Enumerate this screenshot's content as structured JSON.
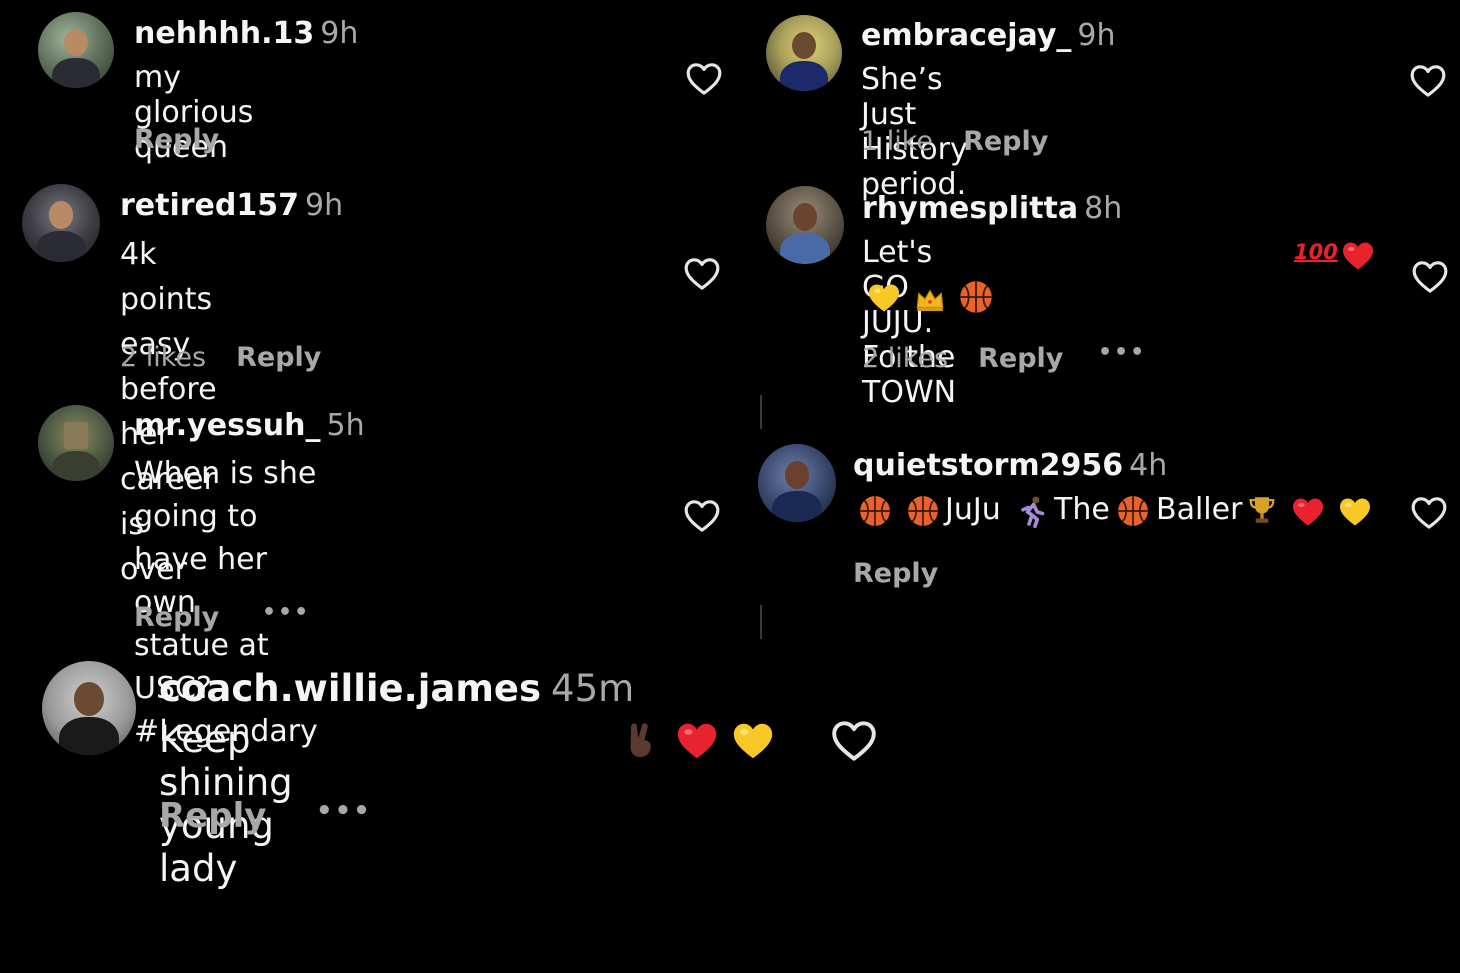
{
  "comments": [
    {
      "id": "c1",
      "username": "nehhhh.13",
      "time": "9h",
      "lines": [
        "my glorious queen"
      ],
      "likes": "",
      "reply": "Reply"
    },
    {
      "id": "c2",
      "username": "retired157",
      "time": "9h",
      "lines": [
        "4k points easy before her career is",
        "over"
      ],
      "likes": "2 likes",
      "reply": "Reply"
    },
    {
      "id": "c3",
      "username": "mr.yessuh_",
      "time": "5h",
      "lines": [
        "When is she going to have her own",
        "statue at USC?",
        "#Legendary"
      ],
      "likes": "",
      "reply": "Reply",
      "more": "•••"
    },
    {
      "id": "c4",
      "username": "embracejay_",
      "time": "9h",
      "lines": [
        "She’s Just History period."
      ],
      "likes": "1 like",
      "reply": "Reply"
    },
    {
      "id": "c5",
      "username": "rhymesplitta",
      "time": "8h",
      "lines": [
        "Let's GO JUJU. Fo the TOWN"
      ],
      "likes": "2 likes",
      "reply": "Reply",
      "more": "•••"
    },
    {
      "id": "c6",
      "username": "quietstorm2956",
      "time": "4h",
      "text_parts": [
        "JuJu",
        "The",
        "Baller"
      ],
      "likes": "",
      "reply": "Reply"
    },
    {
      "id": "c7",
      "username": "coach.willie.james",
      "time": "45m",
      "lines": [
        "Keep shining young lady"
      ],
      "likes": "",
      "reply": "Reply",
      "more": "•••"
    }
  ],
  "emoji_glyphs": {
    "hundred": "100"
  },
  "icons": [
    "heart-outline-icon",
    "basketball-icon",
    "crown-icon",
    "red-heart-icon",
    "yellow-heart-icon",
    "trophy-icon",
    "victory-hand-icon",
    "runner-icon"
  ],
  "colors": {
    "background": "#000000",
    "text": "#f5f5f5",
    "muted": "#a8a8a8",
    "red_heart": "#e8222f",
    "yellow_heart": "#f7c826",
    "basketball": "#e8622a"
  }
}
